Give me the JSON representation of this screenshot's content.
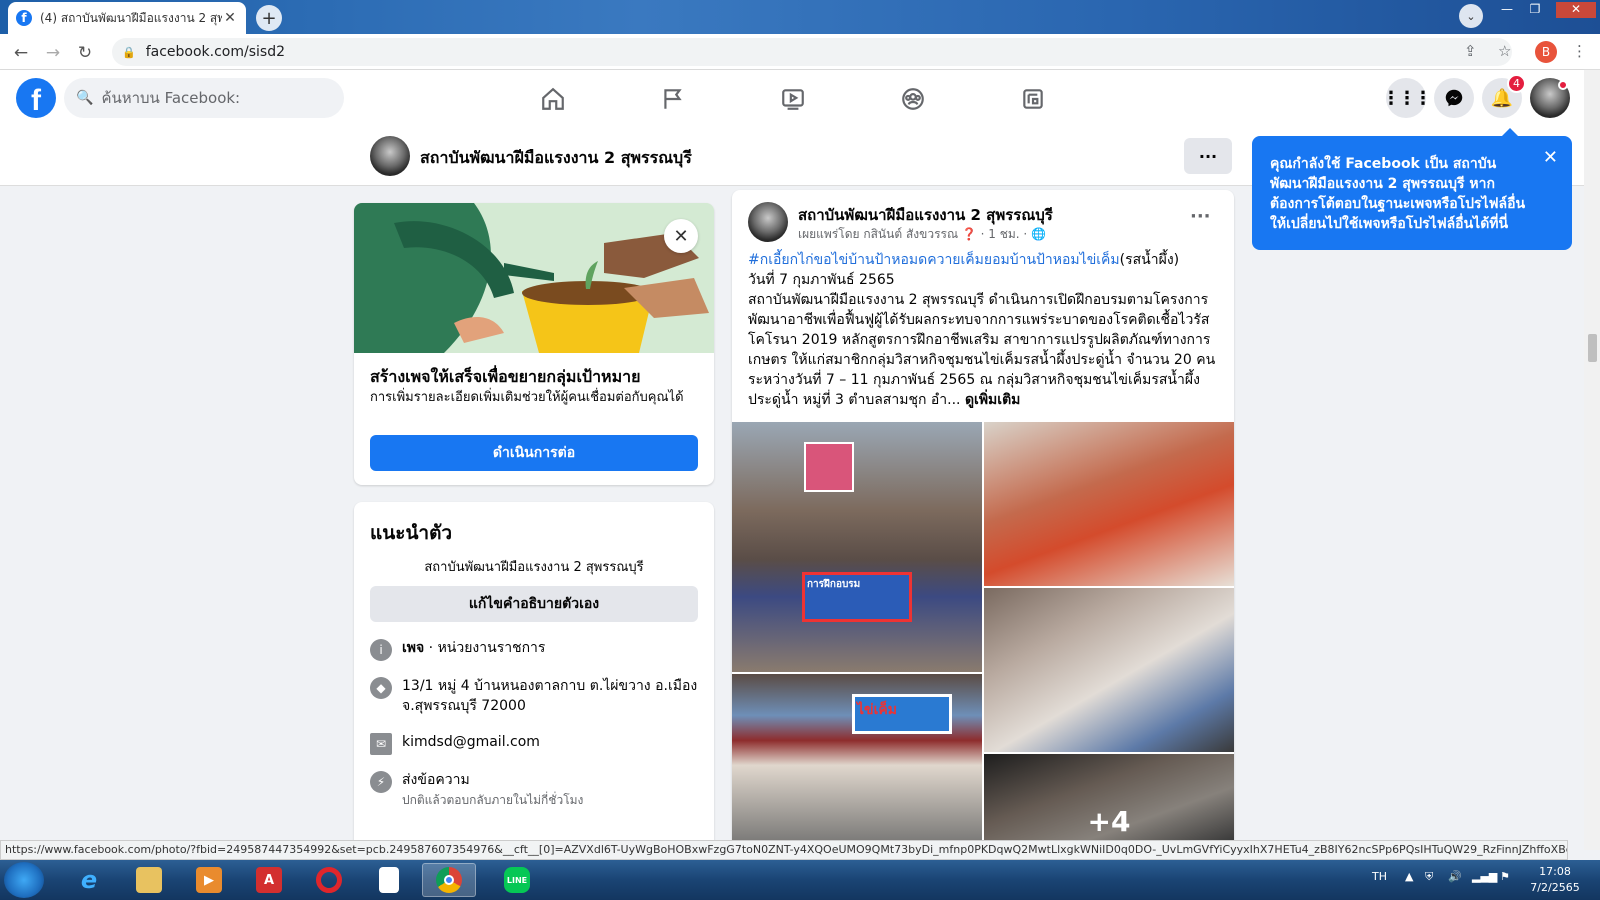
{
  "browser": {
    "tab_title": "(4) สถาบันพัฒนาฝีมือแรงงาน 2 สุพรรณ",
    "url": "facebook.com/sisd2",
    "profile_initial": "B",
    "status_url": "https://www.facebook.com/photo/?fbid=249587447354992&set=pcb.249587607354976&__cft__[0]=AZVXdl6T-UyWgBoHOBxwFzgG7toN0ZNT-y4XQOeUMO9QMt73byDi_mfnp0PKDqwQ2MwtLlxgkWNiID0q0DO-_UvLmGVfYiCyyxIhX7HETu4_zB8IY62ncSPp6PQsIHTuQW29_RzFinnJZhffoXBcqtuQ..."
  },
  "fb": {
    "search_placeholder": "ค้นหาบน Facebook:",
    "notification_count": "4"
  },
  "page_header": {
    "name": "สถาบันพัฒนาฝีมือแรงงาน 2 สุพรรณบุรี",
    "more_label": "···"
  },
  "tooltip": {
    "text": "คุณกำลังใช้ Facebook เป็น สถาบันพัฒนาฝีมือแรงงาน 2 สุพรรณบุรี หากต้องการโต้ตอบในฐานะเพจหรือโปรไฟล์อื่น ให้เปลี่ยนไปใช้เพจหรือโปรไฟล์อื่นได้ที่นี่"
  },
  "promo": {
    "title": "สร้างเพจให้เสร็จเพื่อขยายกลุ่มเป้าหมาย",
    "description": "การเพิ่มรายละเอียดเพิ่มเติมช่วยให้ผู้คนเชื่อมต่อกับคุณได้",
    "button": "ดำเนินการต่อ"
  },
  "intro": {
    "title": "แนะนำตัว",
    "bio": "สถาบันพัฒนาฝีมือแรงงาน 2 สุพรรณบุรี",
    "edit_button": "แก้ไขคำอธิบายตัวเอง",
    "category_bold": "เพจ",
    "category_rest": " · หน่วยงานราชการ",
    "address": "13/1 หมู่ 4 บ้านหนองตาลกาบ ต.ไผ่ขวาง อ.เมือง จ.สุพรรณบุรี 72000",
    "email": "kimdsd@gmail.com",
    "message_label": "ส่งข้อความ",
    "message_sub": "ปกติแล้วตอบกลับภายในไม่กี่ชั่วโมง"
  },
  "post": {
    "author": "สถาบันพัฒนาฝีมือแรงงาน 2 สุพรรณบุรี",
    "meta": "เผยแพร่โดย กสินันต์ สังขวรรณ ❓ · 1 ชม. · 🌐",
    "hashtag": "#กเอี้ยกไก่ขอไข่บ้านป้าหอมดควายเค็มยอมบ้านป้าหอมไข่เค็ม",
    "hashtag_suffix": "(รสน้ำผึ้ง)",
    "line2": "วันที่ 7 กุมภาพันธ์ 2565",
    "body": "สถาบันพัฒนาฝีมือแรงงาน 2 สุพรรณบุรี ดำเนินการเปิดฝึกอบรมตามโครงการพัฒนาอาชีพเพื่อฟื้นฟูผู้ได้รับผลกระทบจากการแพร่ระบาดของโรคติดเชื้อไวรัสโคโรนา 2019 หลักสูตรการฝึกอาชีพเสริม สาขาการแปรรูปผลิตภัณฑ์ทางการเกษตร ให้แก่สมาชิกกลุ่มวิสาหกิจชุมชนไข่เค็มรสน้ำผึ้งประดู่น้ำ จำนวน 20 คน ระหว่างวันที่ 7 – 11 กุมภาพันธ์ 2565 ณ กลุ่มวิสาหกิจชุมชนไข่เค็มรสน้ำผึ้งประดู่น้ำ หมู่ที่ 3 ตำบลสามชุก อำ... ",
    "see_more": "ดูเพิ่มเติม",
    "photo_sign_1": "การฝึกอบรม",
    "photo_sign_2": "ไข่เค็ม",
    "more_photos": "+4"
  },
  "taskbar": {
    "lang": "TH",
    "time": "17:08",
    "date": "7/2/2565"
  },
  "colors": {
    "fb_blue": "#1877f2",
    "link_blue": "#216fdb",
    "badge_red": "#e41e3f"
  }
}
